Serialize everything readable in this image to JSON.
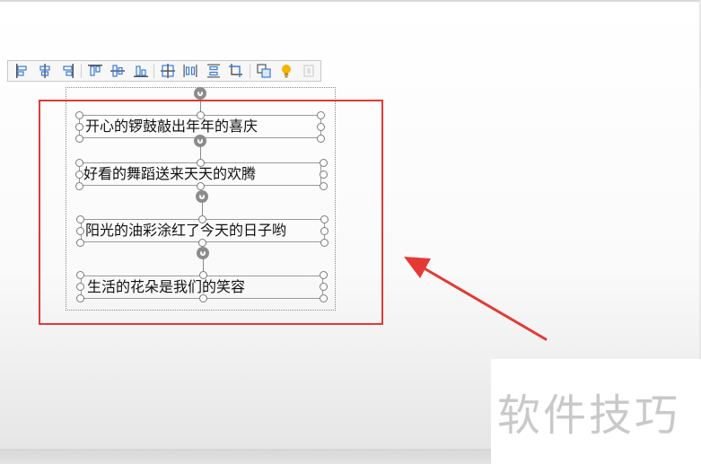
{
  "toolbar": {
    "buttons": [
      {
        "icon": "align-left-icon"
      },
      {
        "icon": "align-center-icon"
      },
      {
        "icon": "align-right-icon"
      },
      {
        "icon": "align-top-icon"
      },
      {
        "icon": "align-middle-icon"
      },
      {
        "icon": "align-bottom-icon"
      },
      {
        "icon": "distribute-center-icon"
      },
      {
        "icon": "distribute-horizontal-icon"
      },
      {
        "icon": "distribute-vertical-icon"
      },
      {
        "icon": "crop-icon"
      },
      {
        "icon": "group-icon"
      },
      {
        "icon": "lightbulb-icon"
      },
      {
        "icon": "more-disabled-icon"
      }
    ]
  },
  "textboxes": [
    {
      "text": "开心的锣鼓敲出年年的喜庆"
    },
    {
      "text": "好看的舞蹈送来天天的欢腾"
    },
    {
      "text": "阳光的油彩涂红了今天的日子哟"
    },
    {
      "text": "生活的花朵是我们的笑容"
    }
  ],
  "annotation": {
    "frame_color": "#e53935",
    "arrow_color": "#e53935"
  },
  "watermark": {
    "text": "软件技巧"
  }
}
